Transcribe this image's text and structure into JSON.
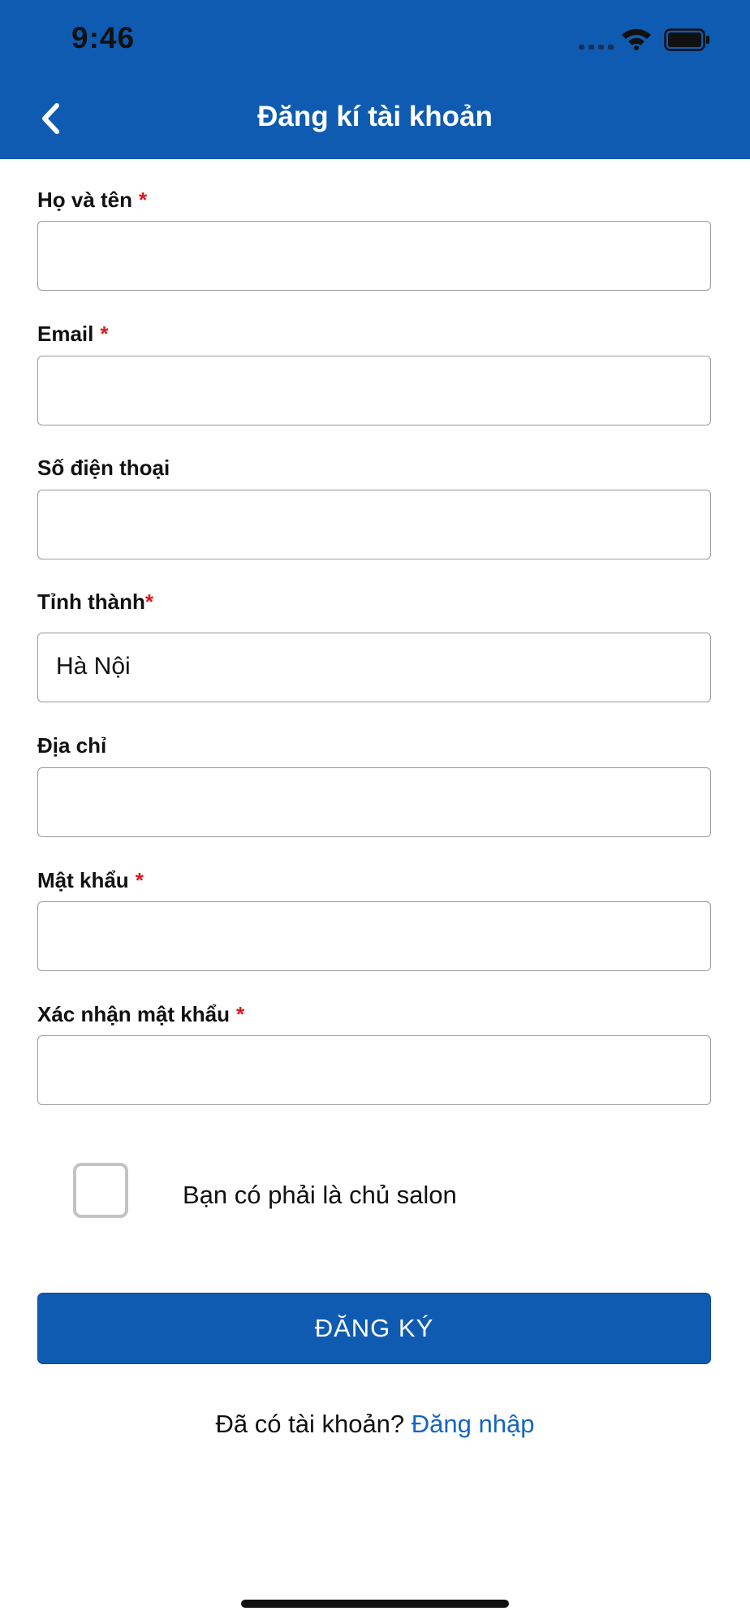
{
  "status_bar": {
    "time": "9:46"
  },
  "header": {
    "title": "Đăng kí tài khoản"
  },
  "form": {
    "fields": [
      {
        "label": "Họ và tên",
        "required": "*",
        "value": ""
      },
      {
        "label": "Email",
        "required": "*",
        "value": ""
      },
      {
        "label": "Số điện thoại",
        "required": "",
        "value": ""
      },
      {
        "label": "Tỉnh thành",
        "required": "*",
        "value": "Hà Nội"
      },
      {
        "label": "Địa chỉ",
        "required": "",
        "value": ""
      },
      {
        "label": "Mật khẩu",
        "required": "*",
        "value": ""
      },
      {
        "label": "Xác nhận mật khẩu",
        "required": "*",
        "value": ""
      }
    ],
    "salon_owner_checkbox": {
      "label": "Bạn có phải là chủ salon",
      "checked": false
    },
    "submit_label": "ĐĂNG KÝ",
    "login_prompt": "Đã có tài khoản?",
    "login_link": "Đăng nhập"
  },
  "colors": {
    "primary": "#0f5bb1",
    "required_mark": "#e0161f",
    "link": "#1565c0"
  }
}
